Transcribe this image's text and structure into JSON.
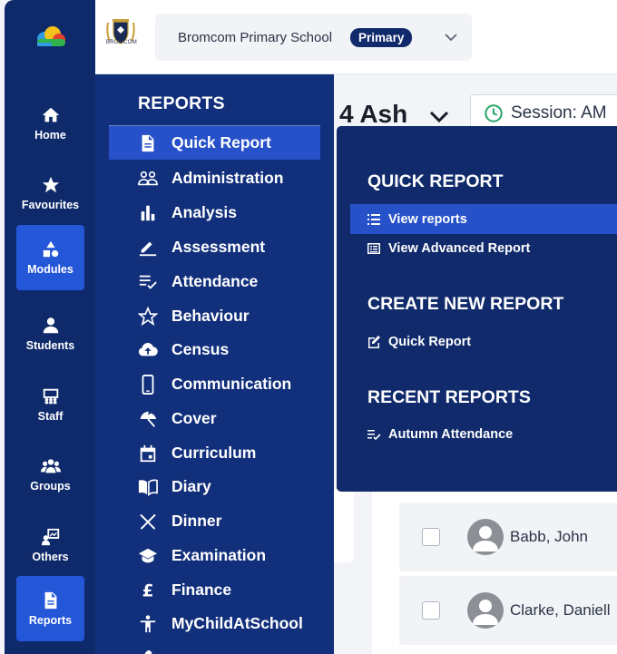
{
  "rail": {
    "items": [
      {
        "label": "Home",
        "icon": "home-icon"
      },
      {
        "label": "Favourites",
        "icon": "star-icon"
      },
      {
        "label": "Modules",
        "icon": "modules-icon"
      },
      {
        "label": "Students",
        "icon": "person-icon"
      },
      {
        "label": "Staff",
        "icon": "staff-icon"
      },
      {
        "label": "Groups",
        "icon": "groups-icon"
      },
      {
        "label": "Others",
        "icon": "others-icon"
      },
      {
        "label": "Reports",
        "icon": "document-icon"
      }
    ],
    "active_items": [
      "Modules",
      "Reports"
    ]
  },
  "header": {
    "crest_text": "BROMCOM",
    "school_name": "Bromcom Primary School",
    "school_badge": "Primary"
  },
  "reports_menu": {
    "title": "REPORTS",
    "items": [
      {
        "label": "Quick Report",
        "icon": "document-icon"
      },
      {
        "label": "Administration",
        "icon": "people-icon"
      },
      {
        "label": "Analysis",
        "icon": "bar-chart-icon"
      },
      {
        "label": "Assessment",
        "icon": "pencil-icon"
      },
      {
        "label": "Attendance",
        "icon": "checklist-icon"
      },
      {
        "label": "Behaviour",
        "icon": "star-outline-icon"
      },
      {
        "label": "Census",
        "icon": "cloud-upload-icon"
      },
      {
        "label": "Communication",
        "icon": "phone-icon"
      },
      {
        "label": "Cover",
        "icon": "umbrella-icon"
      },
      {
        "label": "Curriculum",
        "icon": "calendar-icon"
      },
      {
        "label": "Diary",
        "icon": "book-icon"
      },
      {
        "label": "Dinner",
        "icon": "cutlery-icon"
      },
      {
        "label": "Examination",
        "icon": "graduation-cap-icon"
      },
      {
        "label": "Finance",
        "icon": "pound-icon"
      },
      {
        "label": "MyChildAtSchool",
        "icon": "child-icon"
      }
    ],
    "active_item": "Quick Report"
  },
  "background": {
    "class_title": "4 Ash",
    "session": "Session: AM",
    "students": [
      "Babb, John",
      "Clarke, Daniell"
    ]
  },
  "flyout": {
    "quick_report_heading": "QUICK REPORT",
    "view_reports": "View reports",
    "view_advanced": "View Advanced Report",
    "create_heading": "CREATE NEW REPORT",
    "create_quick": "Quick Report",
    "recent_heading": "RECENT REPORTS",
    "recent_item": "Autumn Attendance"
  },
  "colors": {
    "rail_bg": "#0f2a6b",
    "panel_bg": "#112f7b",
    "active": "#2751c9",
    "session_clock": "#2aa56a"
  }
}
